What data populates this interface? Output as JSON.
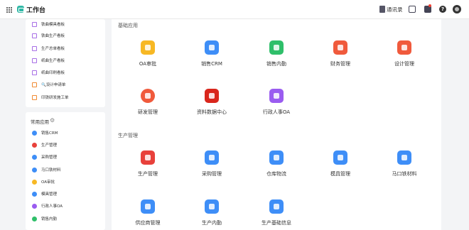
{
  "topbar": {
    "title": "工作台",
    "notice": "通讯录",
    "help": "?"
  },
  "sidebar": {
    "boards": [
      {
        "label": "铁曲模具看板",
        "icon": "monitor-icon",
        "color": "#a86fe6"
      },
      {
        "label": "铁曲生产看板",
        "icon": "monitor-icon",
        "color": "#a86fe6"
      },
      {
        "label": "生产总单看板",
        "icon": "monitor-icon",
        "color": "#a86fe6"
      },
      {
        "label": "纸曲生产看板",
        "icon": "monitor-icon",
        "color": "#a86fe6"
      },
      {
        "label": "纸曲印刷看板",
        "icon": "monitor-icon",
        "color": "#a86fe6"
      },
      {
        "label": "🔍设计申请单",
        "icon": "document-icon",
        "color": "#f08a33"
      },
      {
        "label": "印铁研发施工单",
        "icon": "document-icon",
        "color": "#f08a33"
      }
    ],
    "common_title": "常用应用",
    "common": [
      {
        "label": "销售CRM",
        "icon": "crm-icon",
        "color": "#3e8ef7"
      },
      {
        "label": "生产管理",
        "icon": "production-icon",
        "color": "#e8413b"
      },
      {
        "label": "采购管理",
        "icon": "purchase-icon",
        "color": "#3e8ef7"
      },
      {
        "label": "马口铁材料",
        "icon": "tinplate-icon",
        "color": "#3e8ef7"
      },
      {
        "label": "OA审批",
        "icon": "oa-icon",
        "color": "#f7b824"
      },
      {
        "label": "模具管理",
        "icon": "mold-icon",
        "color": "#3e8ef7"
      },
      {
        "label": "行政人事OA",
        "icon": "hr-icon",
        "color": "#9a5cf0"
      },
      {
        "label": "销售内勤",
        "icon": "sales-office-icon",
        "color": "#2fbf6a"
      }
    ]
  },
  "main": {
    "groups": [
      {
        "title": "基础应用",
        "apps": [
          {
            "label": "OA审批",
            "icon": "oa-icon",
            "color": "#f7b824"
          },
          {
            "label": "销售CRM",
            "icon": "crm-icon",
            "color": "#3e8ef7"
          },
          {
            "label": "销售内勤",
            "icon": "sales-office-icon",
            "color": "#2fbf6a"
          },
          {
            "label": "财务管理",
            "icon": "finance-icon",
            "color": "#f05a3c"
          },
          {
            "label": "设计管理",
            "icon": "design-icon",
            "color": "#f05a3c"
          },
          {
            "label": "研发管理",
            "icon": "rnd-icon",
            "color": "#f05a3c"
          },
          {
            "label": "资料数据中心",
            "icon": "data-center-icon",
            "color": "#d9261c"
          },
          {
            "label": "行政人事OA",
            "icon": "hr-icon",
            "color": "#9a5cf0"
          }
        ]
      },
      {
        "title": "生产管理",
        "apps": [
          {
            "label": "生产管理",
            "icon": "production-icon",
            "color": "#e8413b"
          },
          {
            "label": "采购管理",
            "icon": "purchase-icon",
            "color": "#3e8ef7"
          },
          {
            "label": "仓库物流",
            "icon": "warehouse-icon",
            "color": "#3e8ef7"
          },
          {
            "label": "模具管理",
            "icon": "mold-icon",
            "color": "#3e8ef7"
          },
          {
            "label": "马口铁材料",
            "icon": "tinplate-icon",
            "color": "#3e8ef7"
          },
          {
            "label": "供应商管理",
            "icon": "supplier-icon",
            "color": "#3e8ef7"
          },
          {
            "label": "生产内勤",
            "icon": "production-office-icon",
            "color": "#3e8ef7"
          },
          {
            "label": "生产基础信息",
            "icon": "production-info-icon",
            "color": "#3e8ef7"
          }
        ]
      }
    ]
  }
}
